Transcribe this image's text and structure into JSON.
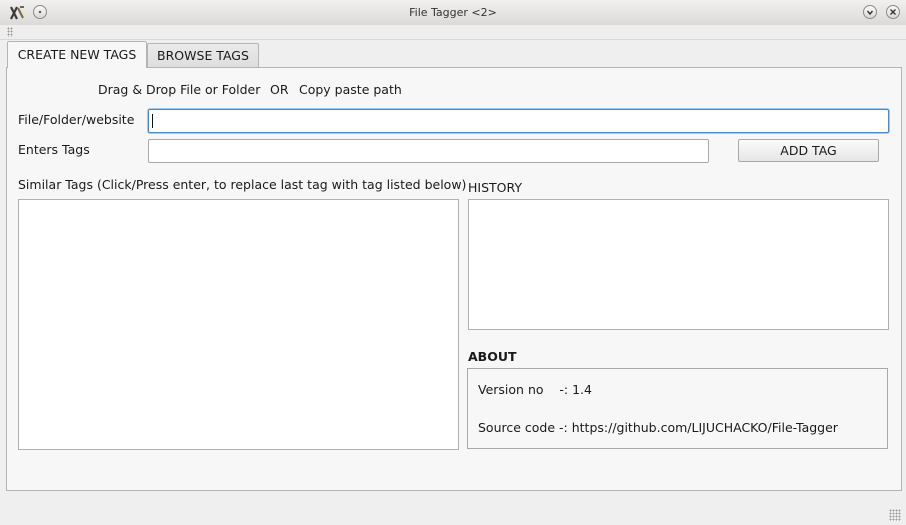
{
  "window": {
    "title": "File Tagger <2>"
  },
  "tabs": [
    {
      "label": "CREATE NEW TAGS",
      "active": true
    },
    {
      "label": "BROWSE TAGS",
      "active": false
    }
  ],
  "create": {
    "hint_drag": "Drag & Drop File or Folder",
    "hint_or": "OR",
    "hint_paste": "Copy paste path",
    "path_label": "File/Folder/website",
    "path_value": "",
    "tags_label": "Enters Tags",
    "tags_value": "",
    "add_tag_label": "ADD TAG",
    "similar_label": "Similar Tags (Click/Press enter, to replace last tag with tag listed below)",
    "history_label": "HISTORY",
    "about_label": "ABOUT",
    "version_line": "Version no    -: 1.4",
    "source_line": "Source code -: https://github.com/LIJUCHACKO/File-Tagger"
  },
  "colors": {
    "focus_border": "#4a88c8",
    "panel_bg": "#f7f7f7",
    "window_bg": "#efefef"
  },
  "icons": {
    "app": "app-logo-icon",
    "minimize": "chevron-down-icon",
    "close": "close-icon",
    "menu": "window-menu-icon"
  }
}
